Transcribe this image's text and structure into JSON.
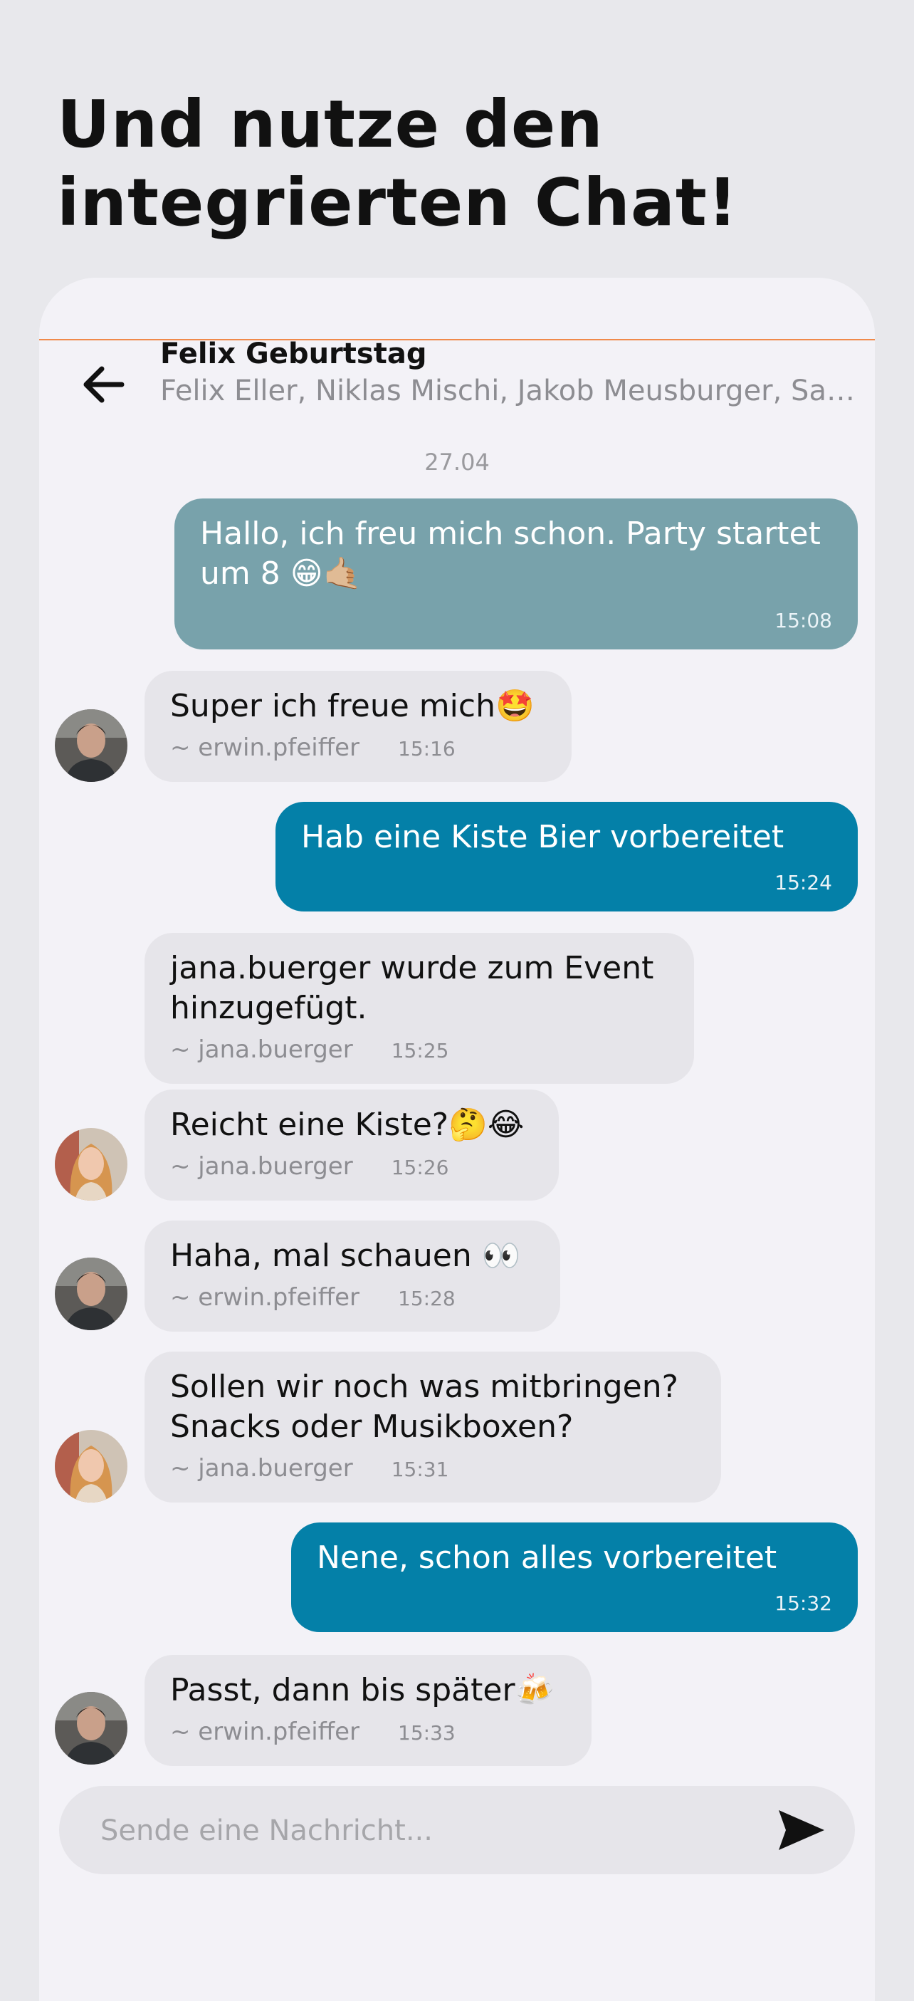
{
  "headline": {
    "line1": "Und nutze den",
    "line2": "integrierten Chat!"
  },
  "chat": {
    "title": "Felix Geburtstag",
    "members": "Felix Eller, Niklas Mischi, Jakob Meusburger, Sandr...",
    "date": "27.04"
  },
  "messages": [
    {
      "text": "Hallo, ich freu mich schon. Party startet um 8 😁🤙🏼",
      "time": "15:08"
    },
    {
      "text": "Super ich freue mich🤩",
      "user": "~ erwin.pfeiffer",
      "time": "15:16"
    },
    {
      "text": "Hab eine Kiste Bier vorbereitet",
      "time": "15:24"
    },
    {
      "text": "jana.buerger wurde zum Event hinzugefügt.",
      "user": "~ jana.buerger",
      "time": "15:25"
    },
    {
      "text": "Reicht eine Kiste?🤔😂",
      "user": "~ jana.buerger",
      "time": "15:26"
    },
    {
      "text": "Haha, mal schauen 👀",
      "user": "~ erwin.pfeiffer",
      "time": "15:28"
    },
    {
      "text": "Sollen wir noch was mitbringen? Snacks oder Musikboxen?",
      "user": "~ jana.buerger",
      "time": "15:31"
    },
    {
      "text": "Nene, schon alles vorbereitet",
      "time": "15:32"
    },
    {
      "text": "Passt, dann bis später🍻",
      "user": "~ erwin.pfeiffer",
      "time": "15:33"
    }
  ],
  "composer": {
    "placeholder": "Sende eine Nachricht..."
  },
  "icons": {
    "back": "arrow-left-icon",
    "send": "send-icon",
    "avatar_erwin": "avatar-erwin",
    "avatar_jana": "avatar-jana"
  },
  "colors": {
    "outgoing_teal_grey": "#78a2ab",
    "outgoing_blue": "#0480a8",
    "incoming": "#e6e5ea",
    "accent_line": "#f08a4b"
  }
}
